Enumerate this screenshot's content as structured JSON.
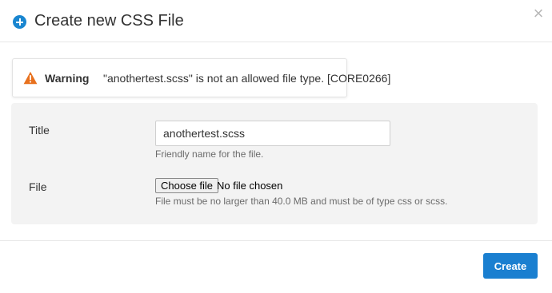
{
  "dialog": {
    "title": "Create new CSS File",
    "close_symbol": "×",
    "icons": {
      "title": "plus-circle-icon",
      "close": "close-icon",
      "warning": "warning-triangle-icon"
    },
    "accent_color": "#1a86d0"
  },
  "warning": {
    "label": "Warning",
    "message": "\"anothertest.scss\" is not an allowed file type. [CORE0266]",
    "icon_color": "#e8711e"
  },
  "form": {
    "title_field": {
      "label": "Title",
      "value": "anothertest.scss",
      "hint": "Friendly name for the file."
    },
    "file_field": {
      "label": "File",
      "button_label": "Choose file",
      "status": "No file chosen",
      "hint": "File must be no larger than 40.0 MB and must be of type css or scss."
    }
  },
  "footer": {
    "create_label": "Create",
    "create_color": "#1a7fd0"
  }
}
